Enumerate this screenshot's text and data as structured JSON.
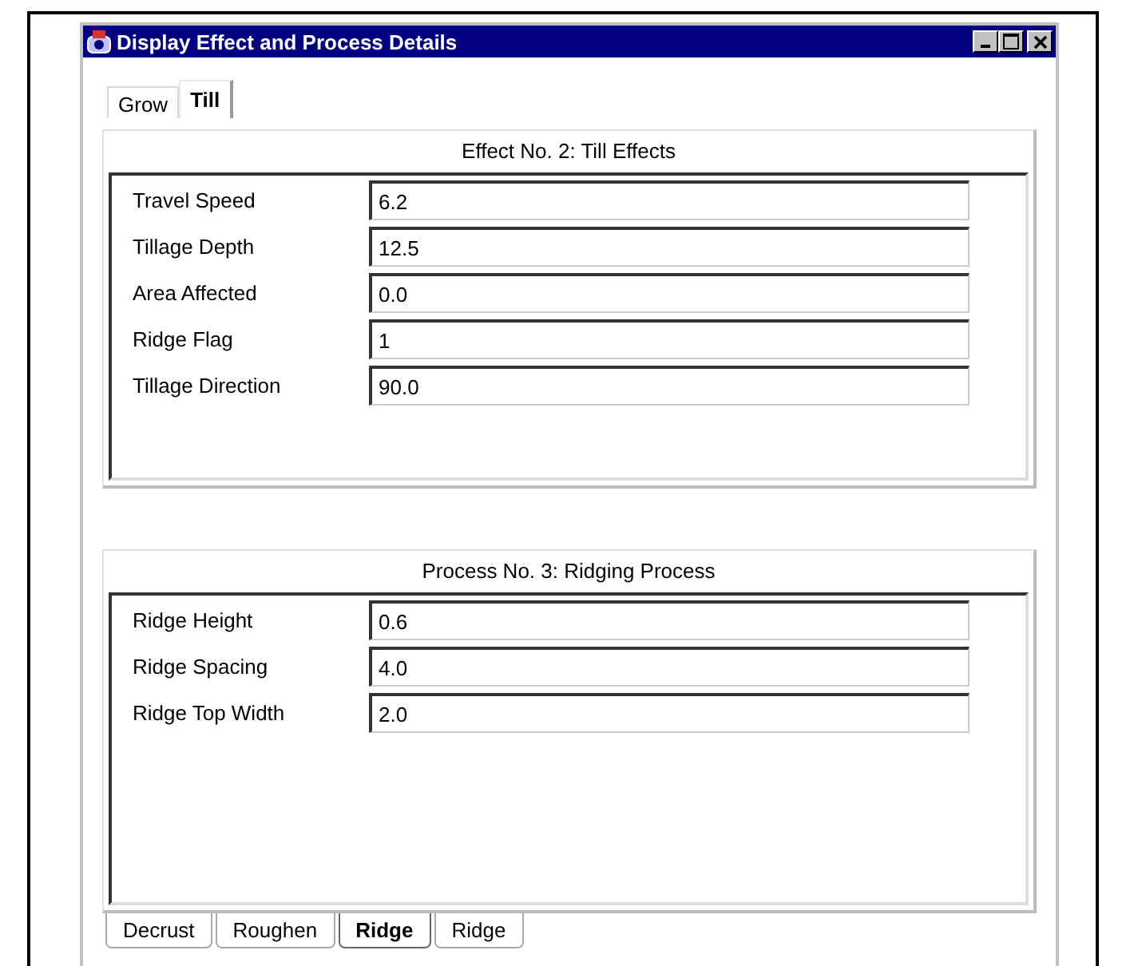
{
  "window": {
    "title": "Display Effect and Process Details"
  },
  "top_tabs": [
    {
      "label": "Grow",
      "selected": false
    },
    {
      "label": "Till",
      "selected": true
    }
  ],
  "panels": [
    {
      "title": "Effect No. 2: Till Effects",
      "fields": [
        {
          "label": "Travel Speed",
          "value": "6.2"
        },
        {
          "label": "Tillage Depth",
          "value": "12.5"
        },
        {
          "label": "Area Affected",
          "value": "0.0"
        },
        {
          "label": "Ridge Flag",
          "value": "1"
        },
        {
          "label": "Tillage Direction",
          "value": "90.0"
        }
      ]
    },
    {
      "title": "Process No. 3: Ridging Process",
      "fields": [
        {
          "label": "Ridge Height",
          "value": "0.6"
        },
        {
          "label": "Ridge Spacing",
          "value": "4.0"
        },
        {
          "label": "Ridge Top Width",
          "value": "2.0"
        }
      ]
    }
  ],
  "bottom_tabs": [
    {
      "label": "Decrust",
      "selected": false
    },
    {
      "label": "Roughen",
      "selected": false
    },
    {
      "label": "Ridge",
      "selected": true
    },
    {
      "label": "Ridge",
      "selected": false
    }
  ]
}
